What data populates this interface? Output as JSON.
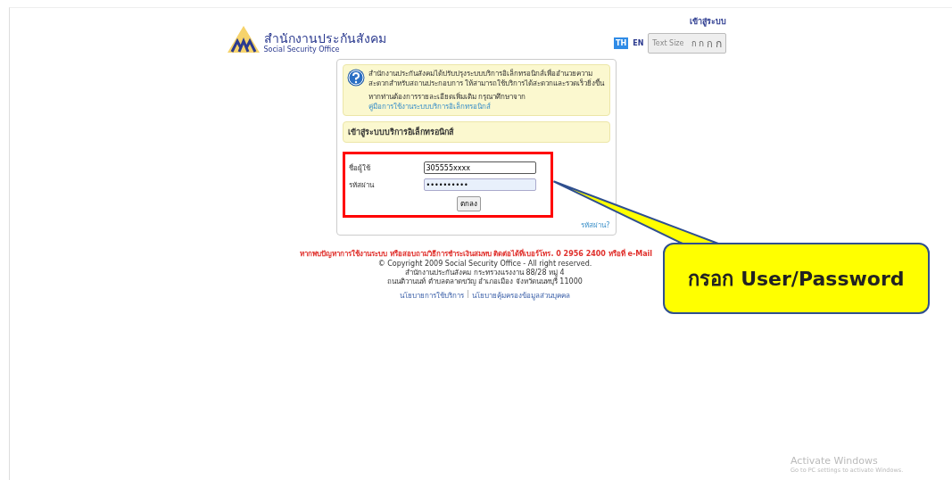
{
  "header": {
    "login_link": "เข้าสู่ระบบ",
    "logo_title": "สำนักงานประกันสังคม",
    "logo_subtitle": "Social Security Office",
    "languages": [
      {
        "label": "TH",
        "selected": true
      },
      {
        "label": "EN",
        "selected": false
      }
    ],
    "text_size": {
      "label": "Text Size",
      "sizes": [
        "ก",
        "ก",
        "ก",
        "ก"
      ]
    }
  },
  "notice": {
    "text": "สำนักงานประกันสังคมได้ปรับปรุงระบบบริการอิเล็กทรอนิกส์เพื่ออำนวยความสะดวกสำหรับสถานประกอบการ ให้สามารถใช้บริการได้สะดวกและรวดเร็วยิ่งขึ้น",
    "more_text": "หากท่านต้องการรายละเอียดเพิ่มเติม กรุณาศึกษาจาก",
    "manual_link": "คู่มือการใช้งานระบบบริการอิเล็กทรอนิกส์"
  },
  "login": {
    "title": "เข้าสู่ระบบบริการอิเล็กทรอนิกส์",
    "username_label": "ชื่อผู้ใช้",
    "username": "305555xxxx",
    "password_label": "รหัสผ่าน",
    "password": "••••••••••",
    "submit": "ตกลง",
    "forgot_link": "รหัสผ่าน?"
  },
  "footer": {
    "contact": "หากพบปัญหาการใช้งานระบบ หรือสอบถามวิธีการชำระเงินสมทบ ติดต่อได้ที่เบอร์โทร. 0 2956 2400 หรือที่ e-Mail",
    "copyright": "© Copyright 2009 Social Security Office - All right reserved.",
    "address_1": "สำนักงานประกันสังคม กระทรวงแรงงาน 88/28 หมู่ 4",
    "address_2": "ถนนติวานนท์ ตำบลตลาดขวัญ อำเภอเมือง จังหวัดนนทบุรี 11000",
    "links": [
      "นโยบายการใช้บริการ",
      "นโยบายคุ้มครองข้อมูลส่วนบุคคล"
    ],
    "link_separator": "|"
  },
  "callout": {
    "text": "กรอก User/Password"
  },
  "os_notice": {
    "title": "Activate Windows",
    "text": "Go to PC settings to activate Windows."
  }
}
